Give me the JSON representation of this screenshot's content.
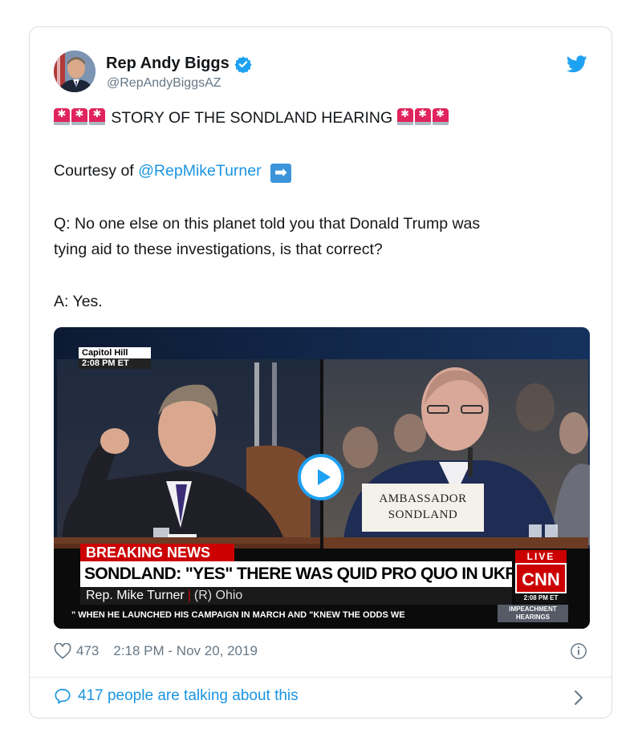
{
  "author": {
    "display_name": "Rep Andy Biggs",
    "handle": "@RepAndyBiggsAZ",
    "verified": true
  },
  "tweet": {
    "headline_text": "STORY OF THE SONDLAND HEARING",
    "courtesy_prefix": "Courtesy of",
    "courtesy_mention": "@RepMikeTurner",
    "question_line1": "Q: No one else on this planet told you that Donald Trump was",
    "question_line2": "tying aid to these investigations, is that correct?",
    "answer": "A: Yes."
  },
  "video": {
    "location_label": "Capitol Hill",
    "location_time": "2:08 PM ET",
    "breaking_label": "BREAKING NEWS",
    "headline": "SONDLAND: \"YES\" THERE WAS QUID PRO QUO IN UKRAINE SCANDAL",
    "speaker_name": "Rep. Mike Turner",
    "speaker_party": "(R) Ohio",
    "ticker": "\" WHEN HE LAUNCHED HIS CAMPAIGN IN MARCH AND \"KNEW THE ODDS WE",
    "live_label": "LIVE",
    "network_logo": "CNN",
    "network_time": "2:08 PM ET",
    "segment_line1": "IMPEACHMENT",
    "segment_line2": "HEARINGS",
    "placard_line1": "AMBASSADOR",
    "placard_line2": "SONDLAND"
  },
  "footer": {
    "like_count": "473",
    "timestamp": "2:18 PM - Nov 20, 2019",
    "talking_text": "417 people are talking about this"
  },
  "colors": {
    "link_blue": "#1b95e0",
    "twitter_blue": "#1da1f2",
    "cnn_red": "#cc0000",
    "muted_gray": "#657786"
  },
  "icons": [
    "verified-badge-icon",
    "twitter-bird-icon",
    "siren-emoji",
    "right-arrow-emoji",
    "play-icon",
    "heart-icon",
    "info-icon",
    "speech-bubble-icon",
    "chevron-right-icon"
  ]
}
